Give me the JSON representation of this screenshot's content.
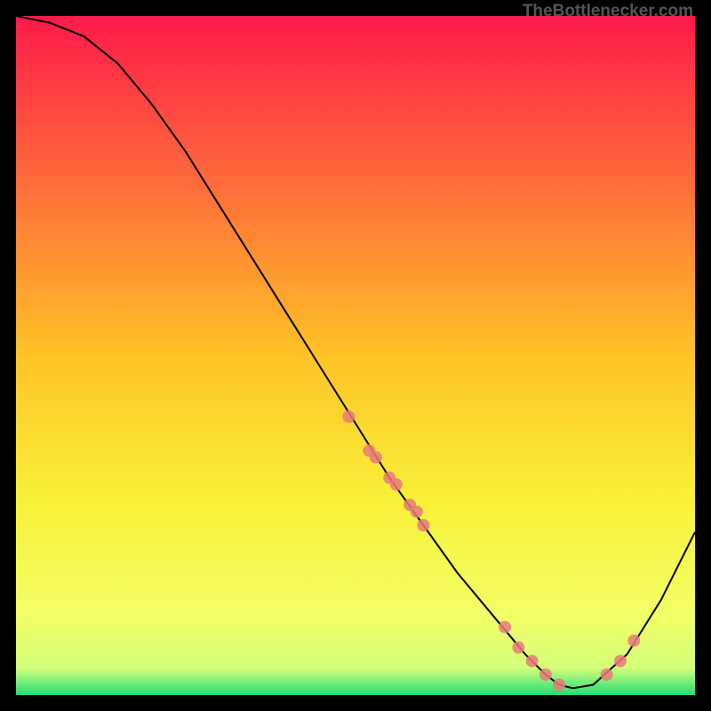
{
  "watermark": "TheBottlenecker.com",
  "chart_data": {
    "type": "line",
    "title": "",
    "xlabel": "",
    "ylabel": "",
    "xlim": [
      0,
      100
    ],
    "ylim": [
      0,
      100
    ],
    "background_gradient": {
      "stops": [
        {
          "offset": 0,
          "color": "#ff1a4a"
        },
        {
          "offset": 25,
          "color": "#ff6d3a"
        },
        {
          "offset": 50,
          "color": "#ffc326"
        },
        {
          "offset": 72,
          "color": "#f8f23a"
        },
        {
          "offset": 88,
          "color": "#f3ff66"
        },
        {
          "offset": 96,
          "color": "#d4ff7a"
        },
        {
          "offset": 100,
          "color": "#22dd77"
        }
      ]
    },
    "series": [
      {
        "name": "bottleneck-curve",
        "type": "line",
        "color": "#000000",
        "x": [
          0,
          5,
          10,
          15,
          20,
          25,
          30,
          35,
          40,
          45,
          50,
          55,
          60,
          65,
          70,
          75,
          78,
          80,
          82,
          85,
          90,
          95,
          100
        ],
        "y": [
          100,
          99,
          97,
          93,
          87,
          80,
          72,
          64,
          56,
          48,
          40,
          32,
          25,
          18,
          12,
          6,
          3,
          1.5,
          1,
          1.5,
          6,
          14,
          24
        ]
      },
      {
        "name": "data-points",
        "type": "scatter",
        "color": "#e87a7a",
        "x": [
          49,
          52,
          53,
          55,
          56,
          58,
          59,
          60,
          72,
          74,
          76,
          78,
          80,
          87,
          89,
          91
        ],
        "y": [
          41,
          36,
          35,
          32,
          31,
          28,
          27,
          25,
          10,
          7,
          5,
          3,
          1.5,
          3,
          5,
          8
        ]
      }
    ]
  }
}
